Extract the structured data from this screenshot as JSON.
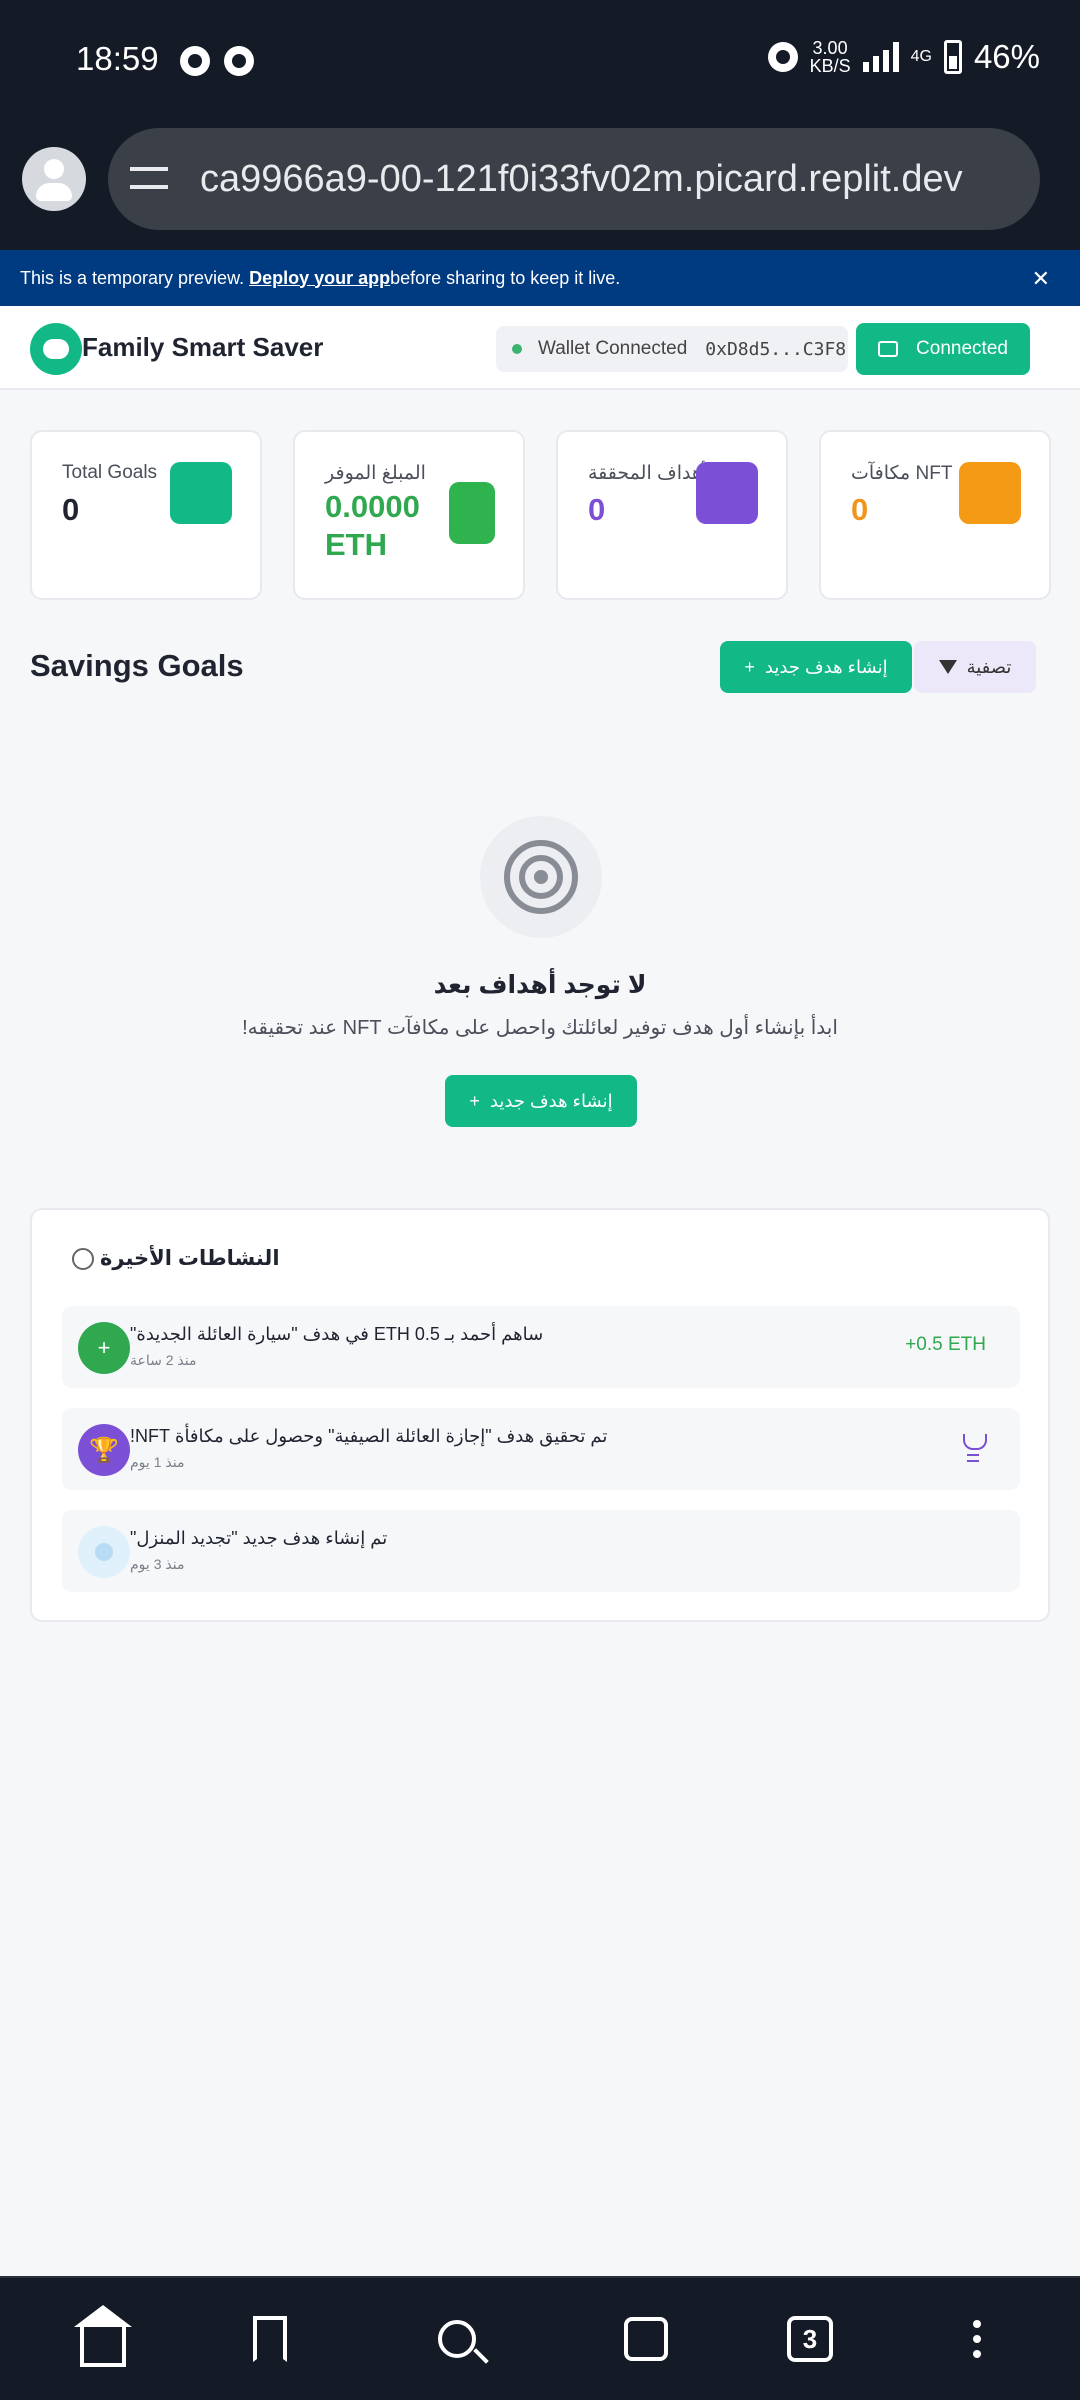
{
  "status_bar": {
    "time": "18:59",
    "network_speed": "3.00",
    "network_speed_unit": "KB/S",
    "network_type": "4G",
    "battery": "46%"
  },
  "browser": {
    "url": "ca9966a9-00-121f0i33fv02m.picard.replit.dev"
  },
  "preview_banner": {
    "text_before": "This is a temporary preview. ",
    "link": "Deploy your app",
    "text_after": " before sharing to keep it live."
  },
  "header": {
    "app_title": "Family Smart Saver",
    "wallet_status": "Wallet Connected",
    "wallet_address": "0xD8d5...C3F8",
    "connected_label": "Connected"
  },
  "stats": [
    {
      "label": "Total Goals",
      "value": "0",
      "value_color": "#1f2430",
      "swatch_color": "#12b886"
    },
    {
      "label": "المبلغ الموفر",
      "value": "0.0000\nETH",
      "value_color": "#2fa84f",
      "swatch_color": "#2fb34f"
    },
    {
      "label": "الأهداف المحققة",
      "value": "0",
      "value_color": "#7b4fd6",
      "swatch_color": "#7b4fd6"
    },
    {
      "label": "مكافآت NFT",
      "value": "0",
      "value_color": "#f0951b",
      "swatch_color": "#f49a14"
    }
  ],
  "goals": {
    "title": "Savings Goals",
    "new_goal_label": "إنشاء هدف جديد",
    "filter_label": "تصفية",
    "empty_title": "لا توجد أهداف بعد",
    "empty_subtitle": "ابدأ بإنشاء أول هدف توفير لعائلتك واحصل على مكافآت NFT عند تحقيقه!",
    "empty_button": "إنشاء هدف جديد"
  },
  "activity": {
    "title": "النشاطات الأخيرة",
    "items": [
      {
        "text": "ساهم أحمد بـ 0.5 ETH في هدف \"سيارة العائلة الجديدة\"",
        "time": "منذ 2 ساعة",
        "amount": "+0.5 ETH",
        "icon_color": "#2fa84f",
        "icon": "+"
      },
      {
        "text": "تم تحقيق هدف \"إجازة العائلة الصيفية\" وحصول على مكافأة NFT!",
        "time": "منذ 1 يوم",
        "amount": "",
        "icon_color": "#7b4fd6",
        "icon": "trophy"
      },
      {
        "text": "تم إنشاء هدف جديد \"تجديد المنزل\"",
        "time": "منذ 3 يوم",
        "amount": "",
        "icon_color": "#dff0fb",
        "icon": "circle"
      }
    ]
  },
  "bottom_nav": {
    "tab_count": "3"
  }
}
